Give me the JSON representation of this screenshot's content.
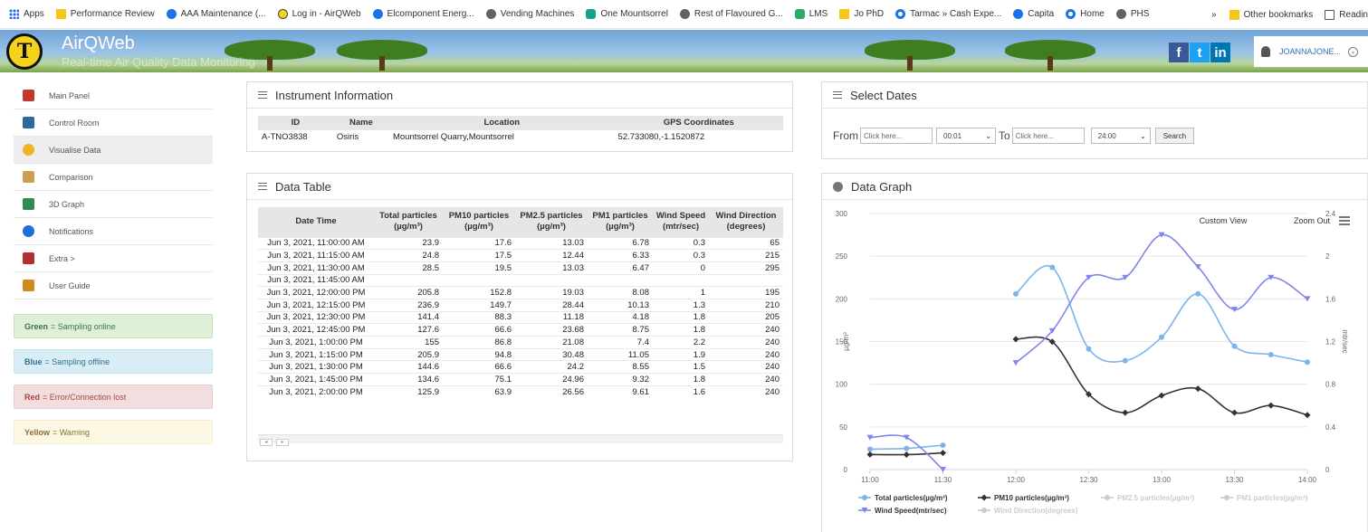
{
  "bookmarks": {
    "items": [
      {
        "label": "Apps",
        "icon": "apps-grid-icon"
      },
      {
        "label": "Performance Review",
        "icon": "folder-icon"
      },
      {
        "label": "AAA Maintenance (...",
        "icon": "site-icon"
      },
      {
        "label": "Log in - AirQWeb",
        "icon": "airqweb-icon"
      },
      {
        "label": "Elcomponent Energ...",
        "icon": "site-icon"
      },
      {
        "label": "Vending Machines",
        "icon": "globe-icon"
      },
      {
        "label": "One Mountsorrel",
        "icon": "site-icon"
      },
      {
        "label": "Rest of Flavoured G...",
        "icon": "globe-icon"
      },
      {
        "label": "LMS",
        "icon": "site-icon"
      },
      {
        "label": "Jo PhD",
        "icon": "folder-icon"
      },
      {
        "label": "Tarmac » Cash Expe...",
        "icon": "site-icon"
      },
      {
        "label": "Capita",
        "icon": "site-icon"
      },
      {
        "label": "Home",
        "icon": "site-icon"
      },
      {
        "label": "PHS",
        "icon": "globe-icon"
      }
    ],
    "overflow": "»",
    "other_bookmarks": "Other bookmarks",
    "reading_list": "Readin"
  },
  "header": {
    "title": "AirQWeb",
    "subtitle": "Real-time Air Quality Data Monitoring",
    "social": {
      "facebook": "f",
      "twitter": "t",
      "linkedin": "in"
    },
    "user": "JOANNAJONE..."
  },
  "sidebar": {
    "items": [
      {
        "label": "Main Panel",
        "icon": "main-panel-icon",
        "color": "#c0392b"
      },
      {
        "label": "Control Room",
        "icon": "control-room-icon",
        "color": "#2c6aa0"
      },
      {
        "label": "Visualise Data",
        "icon": "visualise-data-icon",
        "color": "#f0b429"
      },
      {
        "label": "Comparison",
        "icon": "comparison-icon",
        "color": "#c8a050"
      },
      {
        "label": "3D Graph",
        "icon": "3d-graph-icon",
        "color": "#2e8b57"
      },
      {
        "label": "Notifications",
        "icon": "notifications-icon",
        "color": "#1e6fd9"
      },
      {
        "label": "Extra >",
        "icon": "extra-icon",
        "color": "#b03030"
      },
      {
        "label": "User Guide",
        "icon": "user-guide-icon",
        "color": "#d08a1e"
      }
    ],
    "active_index": 2,
    "legend": [
      {
        "keyword": "Green",
        "text": "= Sampling online",
        "bg": "#dff0d8",
        "border": "#c9e2b3",
        "color": "#3c763d"
      },
      {
        "keyword": "Blue",
        "text": "= Sampling offline",
        "bg": "#d9edf7",
        "border": "#bce8f1",
        "color": "#31708f"
      },
      {
        "keyword": "Red",
        "text": "= Error/Connection lost",
        "bg": "#f2dede",
        "border": "#ebccd1",
        "color": "#a94442"
      },
      {
        "keyword": "Yellow",
        "text": "= Warning",
        "bg": "#fcf8e3",
        "border": "#faebcc",
        "color": "#8a6d3b"
      }
    ]
  },
  "instrument": {
    "title": "Instrument Information",
    "headers": [
      "ID",
      "Name",
      "Location",
      "GPS Coordinates"
    ],
    "row": [
      "A-TNO3838",
      "Osiris",
      "Mountsorrel Quarry,Mountsorrel",
      "52.733080,-1.1520872"
    ]
  },
  "data_table": {
    "title": "Data Table",
    "headers": [
      [
        "Date Time",
        ""
      ],
      [
        "Total particles",
        "(µg/m³)"
      ],
      [
        "PM10 particles",
        "(µg/m³)"
      ],
      [
        "PM2.5 particles",
        "(µg/m³)"
      ],
      [
        "PM1 particles",
        "(µg/m³)"
      ],
      [
        "Wind Speed",
        "(mtr/sec)"
      ],
      [
        "Wind Direction",
        "(degrees)"
      ]
    ],
    "rows": [
      [
        "Jun 3, 2021, 11:00:00 AM",
        "23.9",
        "17.6",
        "13.03",
        "6.78",
        "0.3",
        "65"
      ],
      [
        "Jun 3, 2021, 11:15:00 AM",
        "24.8",
        "17.5",
        "12.44",
        "6.33",
        "0.3",
        "215"
      ],
      [
        "Jun 3, 2021, 11:30:00 AM",
        "28.5",
        "19.5",
        "13.03",
        "6.47",
        "0",
        "295"
      ],
      [
        "Jun 3, 2021, 11:45:00 AM",
        "",
        "",
        "",
        "",
        "",
        ""
      ],
      [
        "Jun 3, 2021, 12:00:00 PM",
        "205.8",
        "152.8",
        "19.03",
        "8.08",
        "1",
        "195"
      ],
      [
        "Jun 3, 2021, 12:15:00 PM",
        "236.9",
        "149.7",
        "28.44",
        "10.13",
        "1.3",
        "210"
      ],
      [
        "Jun 3, 2021, 12:30:00 PM",
        "141.4",
        "88.3",
        "11.18",
        "4.18",
        "1.8",
        "205"
      ],
      [
        "Jun 3, 2021, 12:45:00 PM",
        "127.6",
        "66.6",
        "23.68",
        "8.75",
        "1.8",
        "240"
      ],
      [
        "Jun 3, 2021, 1:00:00 PM",
        "155",
        "86.8",
        "21.08",
        "7.4",
        "2.2",
        "240"
      ],
      [
        "Jun 3, 2021, 1:15:00 PM",
        "205.9",
        "94.8",
        "30.48",
        "11.05",
        "1.9",
        "240"
      ],
      [
        "Jun 3, 2021, 1:30:00 PM",
        "144.6",
        "66.6",
        "24.2",
        "8.55",
        "1.5",
        "240"
      ],
      [
        "Jun 3, 2021, 1:45:00 PM",
        "134.6",
        "75.1",
        "24.96",
        "9.32",
        "1.8",
        "240"
      ],
      [
        "Jun 3, 2021, 2:00:00 PM",
        "125.9",
        "63.9",
        "26.56",
        "9.61",
        "1.6",
        "240"
      ]
    ],
    "scroll_arrows": [
      "◂",
      "▸"
    ]
  },
  "select_dates": {
    "title": "Select Dates",
    "from_label": "From",
    "to_label": "To",
    "from_placeholder": "Click here...",
    "to_placeholder": "Click here...",
    "from_time": "00:01",
    "to_time": "24:00",
    "search_label": "Search"
  },
  "graph": {
    "title": "Data Graph",
    "custom_view": "Custom View",
    "zoom_out": "Zoom Out"
  },
  "chart_data": {
    "type": "line",
    "x": [
      "11:00",
      "11:15",
      "11:30",
      "11:45",
      "12:00",
      "12:15",
      "12:30",
      "12:45",
      "13:00",
      "13:15",
      "13:30",
      "13:45",
      "14:00"
    ],
    "x_tick_labels": [
      "11:00",
      "11:30",
      "12:00",
      "12:30",
      "13:00",
      "13:30",
      "14:00"
    ],
    "ylabel": "µg/m³",
    "y2label": "mtr/sec",
    "ylim": [
      0,
      300
    ],
    "y_ticks": [
      "0",
      "50",
      "100",
      "150",
      "200",
      "250",
      "300"
    ],
    "y2lim": [
      0,
      2.4
    ],
    "y2_ticks": [
      "0",
      "0.4",
      "0.8",
      "1.2",
      "1.6",
      "2",
      "2.4"
    ],
    "grid": true,
    "legend_position": "bottom",
    "series": [
      {
        "name": "Total particles(µg/m³)",
        "axis": "left",
        "color": "#7cb5ec",
        "marker": "circle",
        "visible": true,
        "values": [
          23.9,
          24.8,
          28.5,
          null,
          205.8,
          236.9,
          141.4,
          127.6,
          155,
          205.9,
          144.6,
          134.6,
          125.9
        ]
      },
      {
        "name": "PM10 particles(µg/m³)",
        "axis": "left",
        "color": "#333333",
        "marker": "diamond",
        "visible": true,
        "values": [
          17.6,
          17.5,
          19.5,
          null,
          152.8,
          149.7,
          88.3,
          66.6,
          86.8,
          94.8,
          66.6,
          75.1,
          63.9
        ]
      },
      {
        "name": "PM2.5 particles(µg/m³)",
        "axis": "left",
        "color": "#cccccc",
        "marker": "square",
        "visible": false,
        "values": [
          13.03,
          12.44,
          13.03,
          null,
          19.03,
          28.44,
          11.18,
          23.68,
          21.08,
          30.48,
          24.2,
          24.96,
          26.56
        ]
      },
      {
        "name": "PM1 particles(µg/m³)",
        "axis": "left",
        "color": "#cccccc",
        "marker": "triangle",
        "visible": false,
        "values": [
          6.78,
          6.33,
          6.47,
          null,
          8.08,
          10.13,
          4.18,
          8.75,
          7.4,
          11.05,
          8.55,
          9.32,
          9.61
        ]
      },
      {
        "name": "Wind Speed(mtr/sec)",
        "axis": "right",
        "color": "#8085e9",
        "marker": "triangle-down",
        "visible": true,
        "values": [
          0.3,
          0.3,
          0,
          null,
          1,
          1.3,
          1.8,
          1.8,
          2.2,
          1.9,
          1.5,
          1.8,
          1.6
        ]
      },
      {
        "name": "Wind Direction(degrees)",
        "axis": "right",
        "color": "#cccccc",
        "marker": "circle",
        "visible": false,
        "values": [
          65,
          215,
          295,
          null,
          195,
          210,
          205,
          240,
          240,
          240,
          240,
          240,
          240
        ]
      }
    ]
  }
}
